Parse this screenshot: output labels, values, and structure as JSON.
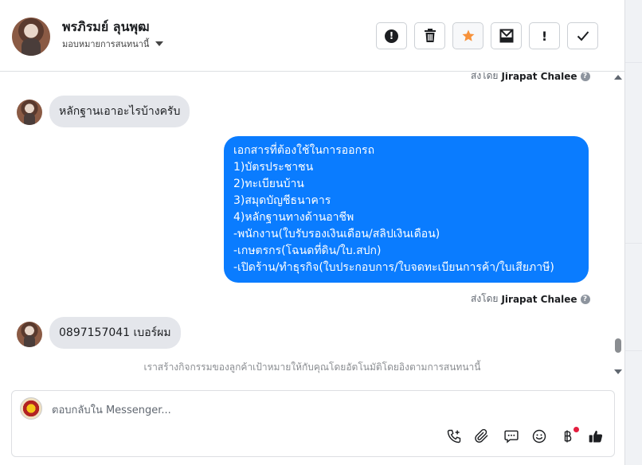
{
  "header": {
    "contact_name": "พรภิรมย์ ลุนพุฒ",
    "assign_label": "มอบหมายการสนทนานี้",
    "actions": [
      {
        "name": "spam-button",
        "icon": "exclamation-circle-icon"
      },
      {
        "name": "delete-button",
        "icon": "trash-icon"
      },
      {
        "name": "star-button",
        "icon": "star-icon",
        "color": "#f7923b"
      },
      {
        "name": "move-to-inbox-button",
        "icon": "inbox-icon"
      },
      {
        "name": "follow-up-button",
        "icon": "exclamation-icon",
        "label": "!"
      },
      {
        "name": "mark-done-button",
        "icon": "check-icon"
      }
    ]
  },
  "chat": {
    "sent_by_prefix": "ส่งโดย",
    "sent_by_name": "Jirapat Chalee",
    "messages": [
      {
        "from": "customer",
        "text": "หลักฐานเอาอะไรบ้างครับ"
      },
      {
        "from": "page",
        "lines": [
          "เอกสารที่ต้องใช้ในการออกรถ",
          "1)บัตรประชาชน",
          "2)ทะเบียนบ้าน",
          "3)สมุดบัญชีธนาคาร",
          "4)หลักฐานทางด้านอาชีพ",
          "-พนักงาน(ใบรับรองเงินเดือน/สลิปเงินเดือน)",
          "-เกษตรกร(โฉนดที่ดิน/ใบ.สปก)",
          "-เปิดร้าน/ทำธุรกิจ(ใบประกอบการ/ใบจดทะเบียนการค้า/ใบเสียภาษี)"
        ]
      },
      {
        "from": "customer",
        "text": "0897157041 เบอร์ผม"
      }
    ],
    "notice": "เราสร้างกิจกรรมของลูกค้าเป้าหมายให้กับคุณโดยอัตโนมัติโดยอิงตามการสนทนานี้"
  },
  "composer": {
    "placeholder": "ตอบกลับใน Messenger...",
    "value": "",
    "tools": [
      "call-add-icon",
      "paperclip-icon",
      "saved-replies-icon",
      "emoji-icon",
      "baht-payment-icon",
      "thumbs-up-icon"
    ]
  },
  "colors": {
    "outgoing_bubble": "#0a7cff",
    "incoming_bubble": "#e4e6eb",
    "star": "#f7923b",
    "notification_dot": "#e41e3f"
  }
}
